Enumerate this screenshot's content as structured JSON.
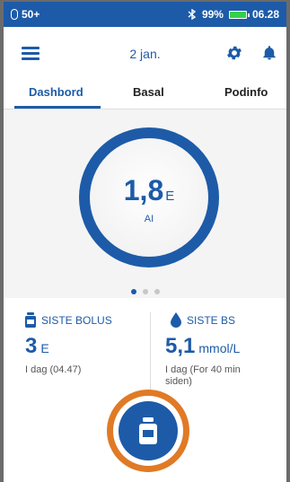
{
  "status_bar": {
    "left_text": "50+",
    "battery_percent": "99%",
    "time": "06.28",
    "battery_color": "#35d04a"
  },
  "header": {
    "date": "2 jan."
  },
  "tabs": [
    {
      "label": "Dashbord",
      "active": true
    },
    {
      "label": "Basal",
      "active": false
    },
    {
      "label": "Podinfo",
      "active": false
    }
  ],
  "iob": {
    "value": "1,8",
    "unit": "E",
    "label": "AI"
  },
  "carousel": {
    "page_count": 3,
    "active_page": 1
  },
  "last_bolus": {
    "title": "SISTE BOLUS",
    "value": "3",
    "unit": "E",
    "detail": "I dag (04.47)"
  },
  "last_bg": {
    "title": "SISTE BS",
    "value": "5,1",
    "unit": "mmol/L",
    "detail_line1": "I dag (For 40 min",
    "detail_line2": "siden)"
  },
  "colors": {
    "primary": "#1d5ba8",
    "accent_highlight": "#e07a26"
  },
  "icons": [
    "pod-icon",
    "bluetooth-icon",
    "battery-icon",
    "hamburger-menu-icon",
    "gear-icon",
    "bell-icon",
    "bolus-vial-icon",
    "blood-drop-icon",
    "bolus-button-icon"
  ]
}
